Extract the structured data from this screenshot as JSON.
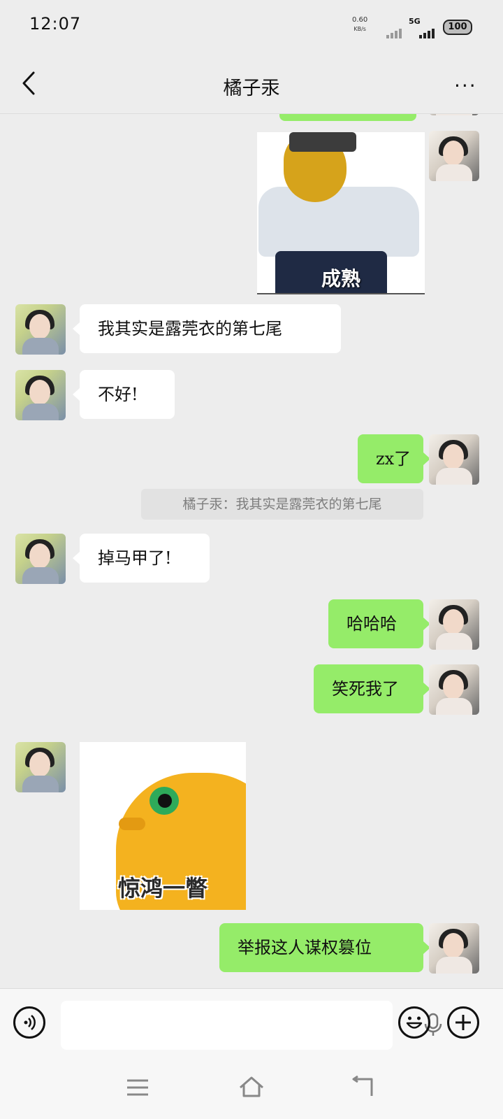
{
  "status_bar": {
    "time": "12:07",
    "net_speed_value": "0.60",
    "net_speed_unit": "KB/s",
    "network_type": "5G",
    "battery": "100"
  },
  "header": {
    "title": "橘子汞",
    "back_icon": "chevron-left-icon",
    "more_icon": "more-dots-icon",
    "more_label": "···"
  },
  "messages": [
    {
      "side": "out",
      "type": "sticker",
      "caption": "成熟"
    },
    {
      "side": "in",
      "type": "text",
      "text": "我其实是露莞衣的第七尾"
    },
    {
      "side": "in",
      "type": "text",
      "text": "不好!"
    },
    {
      "side": "out",
      "type": "text",
      "text": "zx了"
    },
    {
      "side": "system",
      "type": "quote",
      "text": "橘子汞：我其实是露莞衣的第七尾"
    },
    {
      "side": "in",
      "type": "text",
      "text": "掉马甲了!"
    },
    {
      "side": "out",
      "type": "text",
      "text": "哈哈哈"
    },
    {
      "side": "out",
      "type": "text",
      "text": "笑死我了"
    },
    {
      "side": "in",
      "type": "sticker",
      "caption": "惊鸿一瞥"
    },
    {
      "side": "out",
      "type": "text",
      "text": "举报这人谋权篡位"
    }
  ],
  "input_bar": {
    "voice_icon": "voice-icon",
    "placeholder": "",
    "mic_icon": "microphone-icon",
    "emoji_icon": "emoji-icon",
    "plus_icon": "plus-icon"
  },
  "nav_bar": {
    "menu_icon": "menu-icon",
    "home_icon": "home-icon",
    "back_icon": "back-icon"
  },
  "colors": {
    "background": "#ededed",
    "outgoing_bubble": "#95ec69",
    "incoming_bubble": "#ffffff"
  }
}
